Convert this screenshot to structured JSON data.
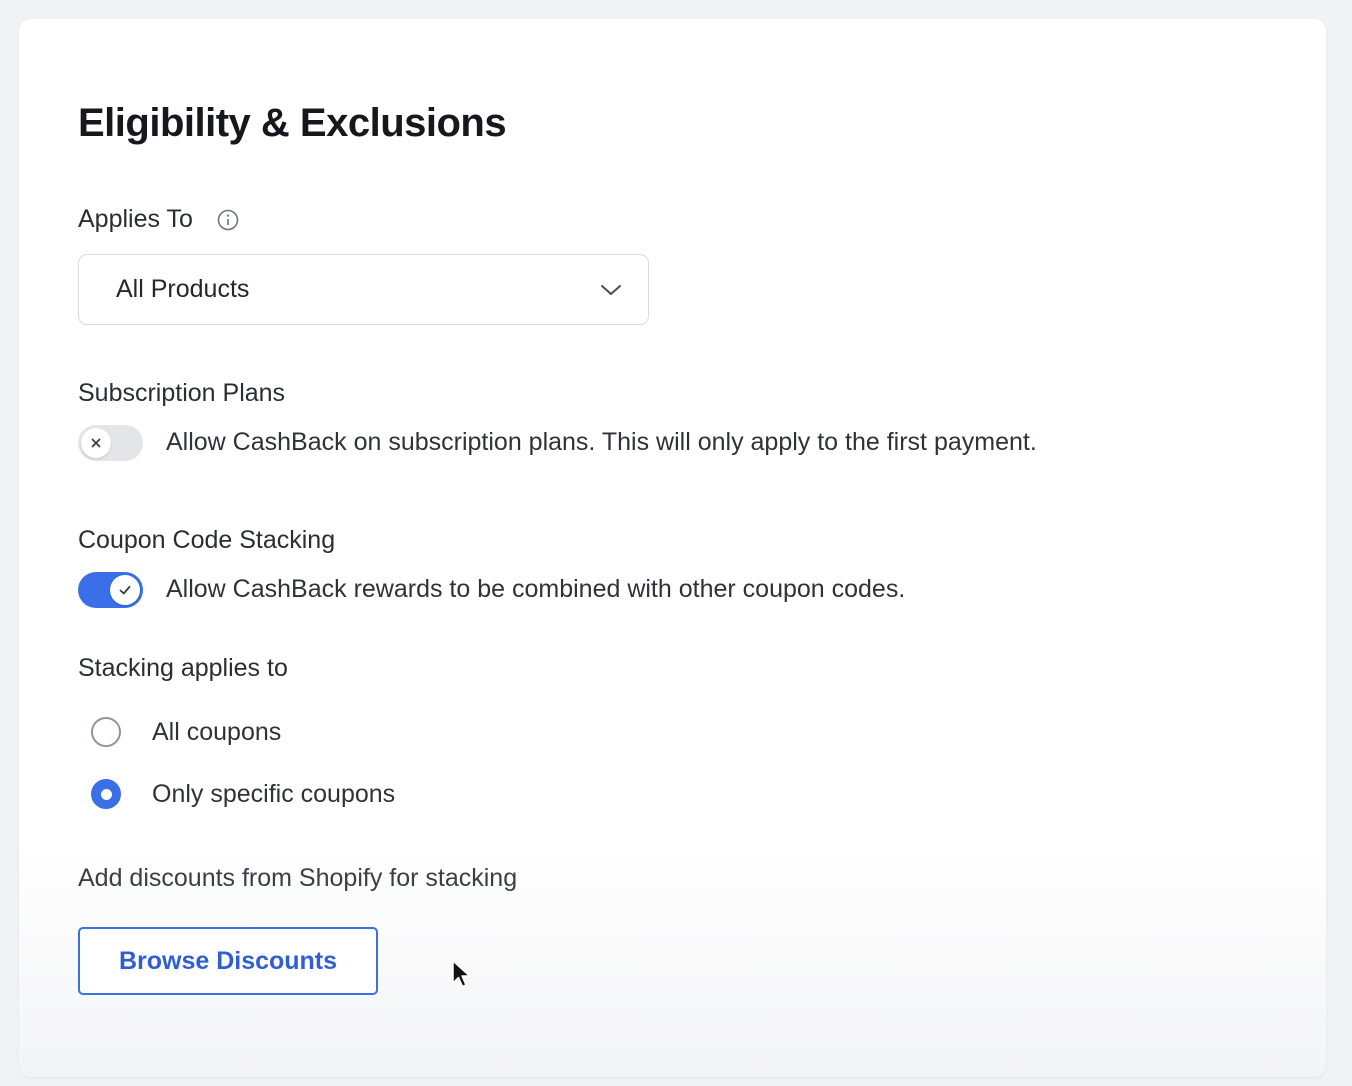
{
  "section": {
    "title": "Eligibility & Exclusions"
  },
  "applies_to": {
    "label": "Applies To",
    "info_icon": "info-icon",
    "selected": "All Products",
    "dropdown_icon": "chevron-down-icon"
  },
  "subscription": {
    "label": "Subscription Plans",
    "toggle_state": "off",
    "description": "Allow CashBack on subscription plans. This will only apply to the first payment."
  },
  "coupon_stacking": {
    "label": "Coupon Code Stacking",
    "toggle_state": "on",
    "description": "Allow CashBack rewards to be combined with other coupon codes."
  },
  "stacking_applies": {
    "label": "Stacking applies to",
    "options": [
      {
        "label": "All coupons",
        "selected": false
      },
      {
        "label": "Only specific coupons",
        "selected": true
      }
    ]
  },
  "shopify": {
    "label": "Add discounts from Shopify for stacking",
    "button_label": "Browse Discounts"
  },
  "colors": {
    "accent": "#3a6fe8",
    "button_text": "#2f5fd6",
    "toggle_off": "#e3e5e8"
  }
}
